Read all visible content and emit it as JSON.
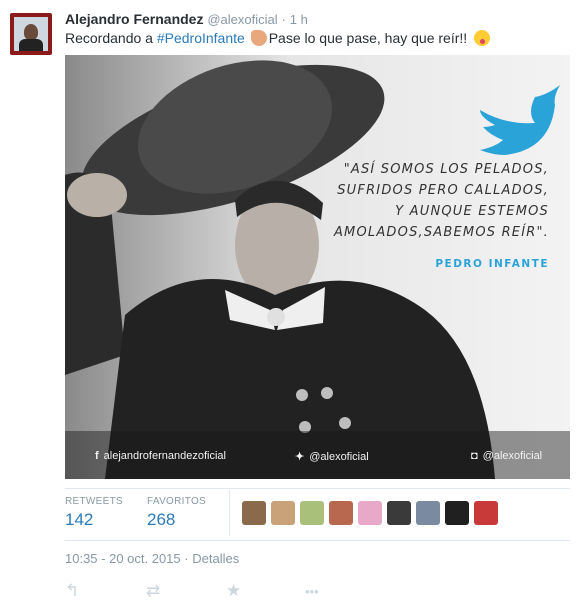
{
  "tweet": {
    "name": "Alejandro Fernandez",
    "handle": "@alexoficial",
    "sep": "·",
    "time": "1 h",
    "text_before": "Recordando a ",
    "hashtag": "#PedroInfante",
    "text_after": "Pase lo que pase, hay que reír!!"
  },
  "image": {
    "quote": [
      "\"ASÍ SOMOS LOS PELADOS,",
      "SUFRIDOS PERO CALLADOS,",
      "Y AUNQUE ESTEMOS",
      "AMOLADOS,SABEMOS REÍR\"."
    ],
    "author": "PEDRO INFANTE",
    "facebook": "alejandrofernandezoficial",
    "twitter": "@alexoficial",
    "instagram": "@alexoficial"
  },
  "stats": {
    "retweets_label": "RETWEETS",
    "retweets": "142",
    "favorites_label": "FAVORITOS",
    "favorites": "268"
  },
  "favoriters": [
    "#8a6a4a",
    "#c9a27a",
    "#a8c07a",
    "#b7684e",
    "#e8a8c8",
    "#3a3a3a",
    "#7a8aa0",
    "#202020",
    "#c83a3a"
  ],
  "meta": {
    "datetime": "10:35 - 20 oct. 2015",
    "sep": "·",
    "details": "Detalles"
  },
  "actions": {
    "reply": "↰",
    "retweet": "⇄",
    "favorite": "★",
    "more": "•••"
  },
  "colors": {
    "link": "#2b7bb9",
    "muted": "#8899a6",
    "twitter_blue": "#2aa4d8"
  }
}
